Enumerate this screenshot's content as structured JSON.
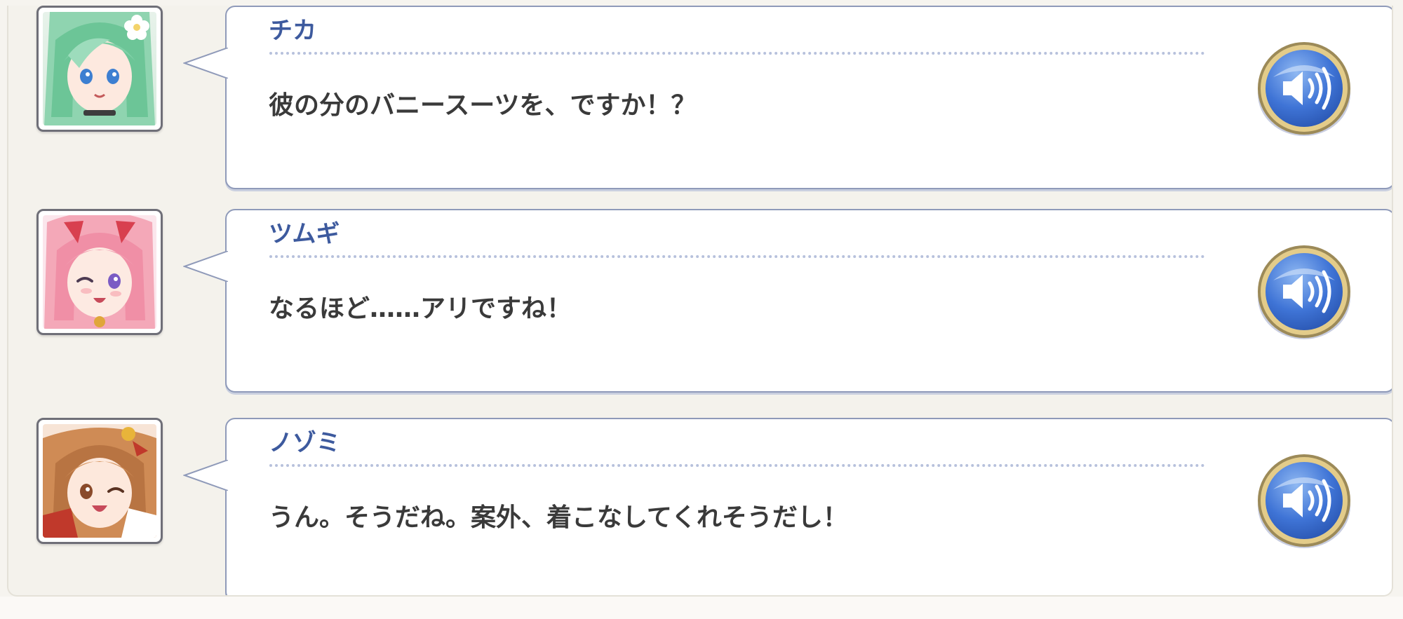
{
  "colors": {
    "name_blue": "#3d5a9e",
    "text_dark": "#3a3a3a",
    "bubble_border": "#8f9ab9",
    "voice_button_blue": "#3f74d6",
    "voice_button_rim": "#c9a95a"
  },
  "log": {
    "entries": [
      {
        "speaker": "チカ",
        "text": "彼の分のバニースーツを、ですか！？",
        "avatar_icon": "chika-portrait",
        "voice_icon": "speaker-volume-icon"
      },
      {
        "speaker": "ツムギ",
        "text": "なるほど……アリですね！",
        "avatar_icon": "tsumugi-portrait",
        "voice_icon": "speaker-volume-icon"
      },
      {
        "speaker": "ノゾミ",
        "text": "うん。そうだね。案外、着こなしてくれそうだし！",
        "avatar_icon": "nozomi-portrait",
        "voice_icon": "speaker-volume-icon"
      }
    ]
  }
}
